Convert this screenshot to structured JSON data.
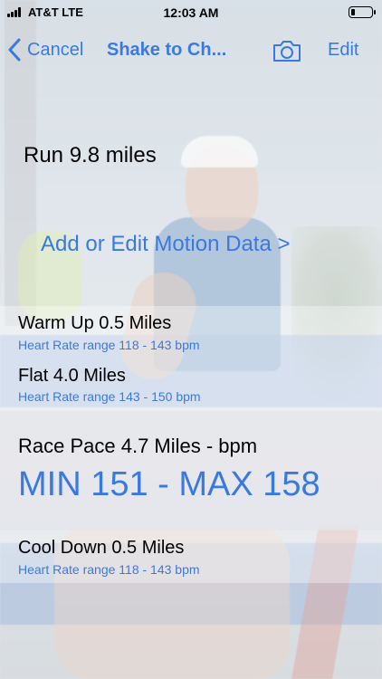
{
  "status_bar": {
    "carrier": "AT&T LTE",
    "time": "12:03 AM",
    "battery_level": 0.2
  },
  "nav": {
    "back_label": "Cancel",
    "title": "Shake to Ch...",
    "camera_icon": "camera-icon",
    "edit_label": "Edit",
    "accent_color": "#3a79e0"
  },
  "workout": {
    "title": "Run 9.8 miles",
    "motion_link": "Add or Edit Motion Data  >"
  },
  "segments": [
    {
      "title": "Warm Up 0.5 Miles",
      "subtitle": "Heart Rate range 118 - 143 bpm"
    },
    {
      "title": "Flat 4.0 Miles",
      "subtitle": "Heart Rate range 143 - 150 bpm"
    },
    {
      "title": "Race Pace 4.7 Miles - bpm",
      "value": "MIN 151 - MAX 158"
    },
    {
      "title": "Cool Down 0.5 Miles",
      "subtitle": "Heart Rate range 118 - 143 bpm"
    }
  ]
}
